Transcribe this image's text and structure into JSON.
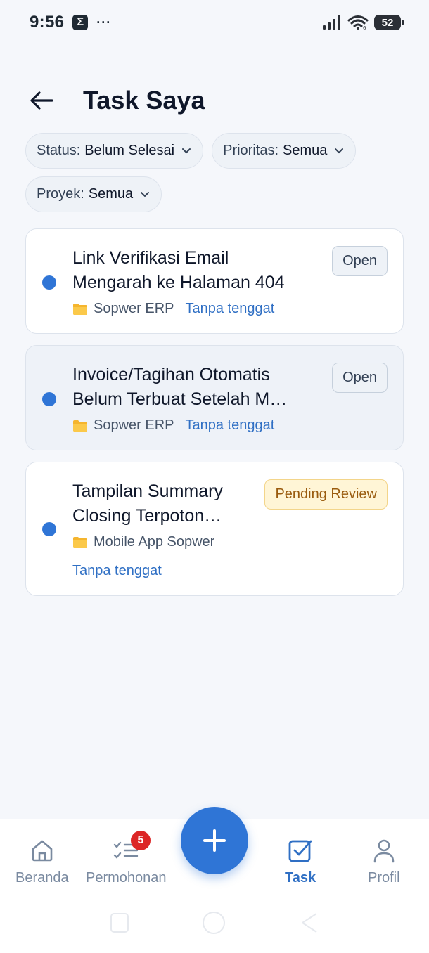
{
  "status_bar": {
    "time": "9:56",
    "app_icon": "Σ",
    "more": "···",
    "battery": "52",
    "icons": [
      "signal-icon",
      "wifi-icon",
      "battery-icon"
    ]
  },
  "header": {
    "back_icon": "arrow-left-icon",
    "title": "Task Saya"
  },
  "filters": [
    {
      "label": "Status:",
      "value": "Belum Selesai"
    },
    {
      "label": "Prioritas:",
      "value": "Semua"
    },
    {
      "label": "Proyek:",
      "value": "Semua"
    }
  ],
  "tasks": [
    {
      "title": "Link Verifikasi Email\nMengarah ke Halaman 404",
      "project": "Sopwer ERP",
      "deadline": "Tanpa tenggat",
      "status": "Open"
    },
    {
      "title": "Invoice/Tagihan Otomatis\nBelum Terbuat Setelah M…",
      "project": "Sopwer ERP",
      "deadline": "Tanpa tenggat",
      "status": "Open"
    },
    {
      "title": "Tampilan Summary\nClosing Terpoton…",
      "project": "Mobile App Sopwer",
      "deadline": "Tanpa tenggat",
      "status": "Pending Review"
    }
  ],
  "bottom_nav": {
    "items": [
      {
        "label": "Beranda",
        "icon": "home-icon"
      },
      {
        "label": "Permohonan",
        "icon": "checklist-icon",
        "badge": "5"
      },
      {
        "label": "Task",
        "icon": "task-check-icon",
        "active": true
      },
      {
        "label": "Profil",
        "icon": "user-icon"
      }
    ],
    "fab_icon": "plus-icon"
  },
  "colors": {
    "accent": "#2f75d6",
    "link": "#2f6fc4",
    "badge_red": "#dc2626",
    "pending_bg": "#fff5d6",
    "pending_text": "#9a5b0e"
  }
}
